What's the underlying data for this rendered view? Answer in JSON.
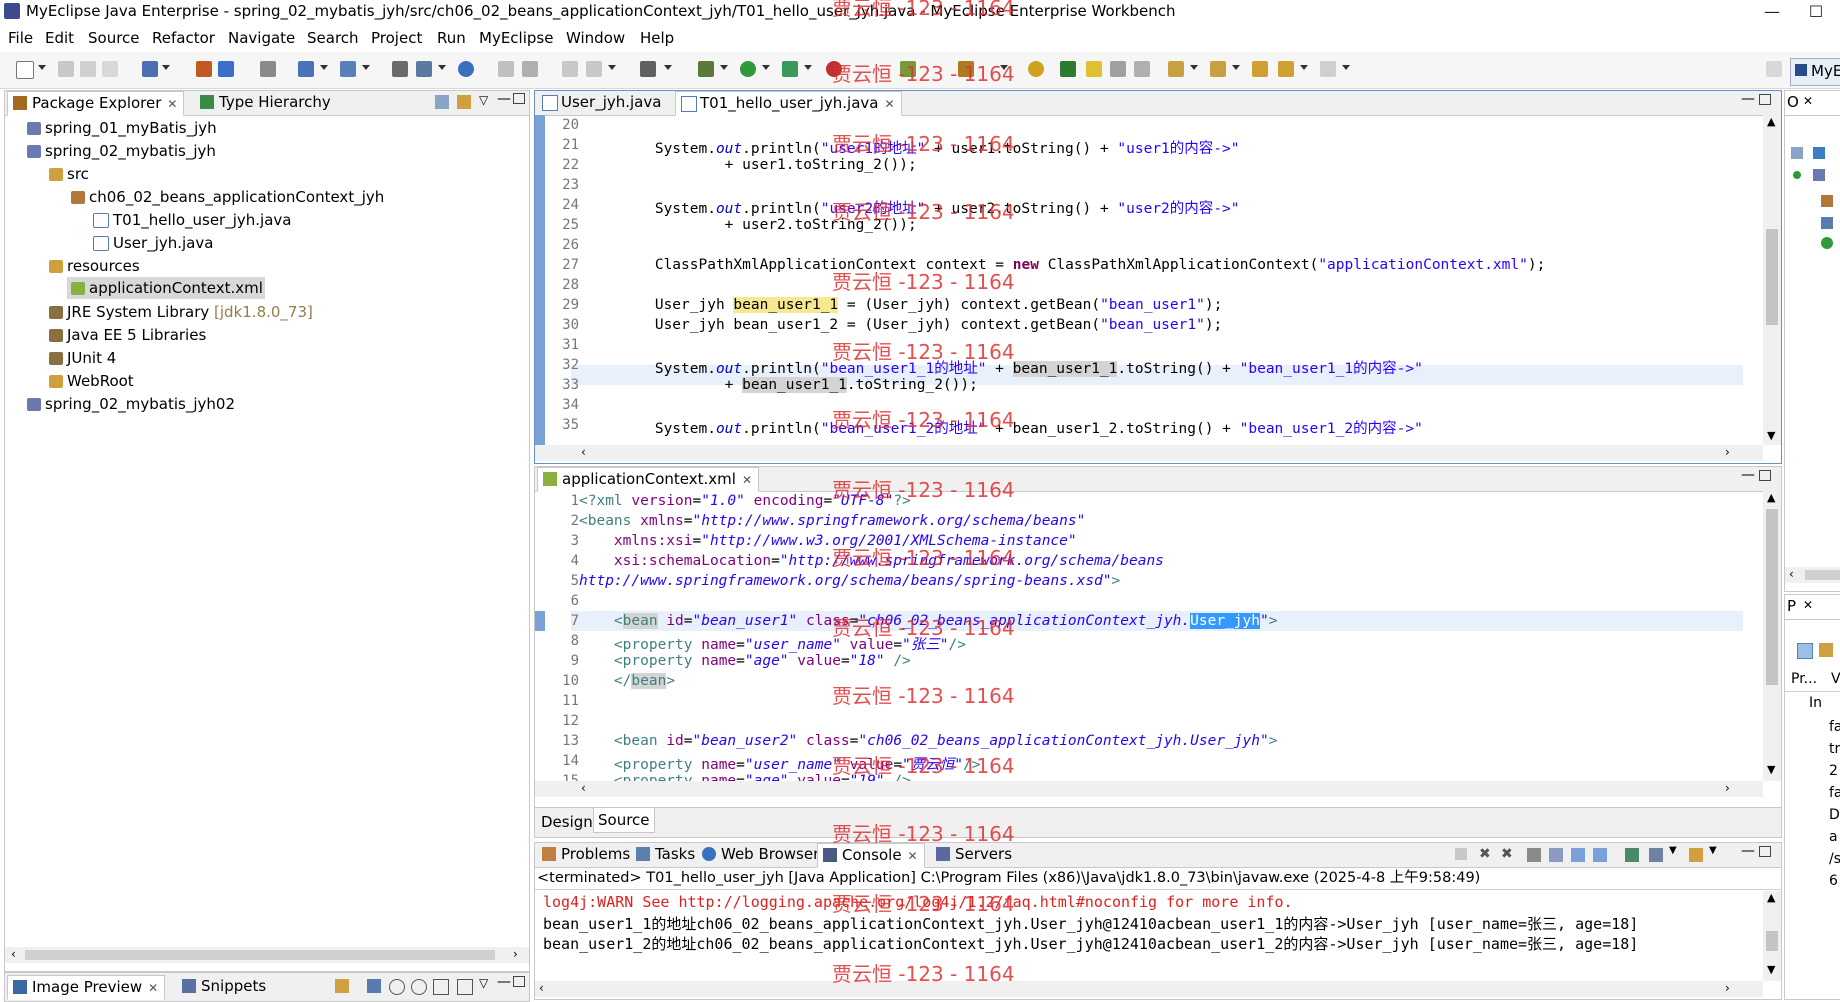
{
  "window": {
    "title": "MyEclipse Java Enterprise - spring_02_mybatis_jyh/src/ch06_02_beans_applicationContext_jyh/T01_hello_user_jyh.java - MyEclipse Enterprise Workbench",
    "minimize": "—",
    "maximize": "☐"
  },
  "menu": [
    "File",
    "Edit",
    "Source",
    "Refactor",
    "Navigate",
    "Search",
    "Project",
    "Run",
    "MyEclipse",
    "Window",
    "Help"
  ],
  "perspective": "MyE",
  "watermark": "贾云恒 -123 - 1164",
  "left_panel": {
    "tabs": [
      "Package Explorer",
      "Type Hierarchy"
    ],
    "tree": [
      {
        "label": "spring_01_myBatis_jyh",
        "depth": 0
      },
      {
        "label": "spring_02_mybatis_jyh",
        "depth": 0
      },
      {
        "label": "src",
        "depth": 1
      },
      {
        "label": "ch06_02_beans_applicationContext_jyh",
        "depth": 2
      },
      {
        "label": "T01_hello_user_jyh.java",
        "depth": 3
      },
      {
        "label": "User_jyh.java",
        "depth": 3
      },
      {
        "label": "resources",
        "depth": 1
      },
      {
        "label": "applicationContext.xml",
        "depth": 2
      },
      {
        "label": "JRE System Library",
        "suffix": "[jdk1.8.0_73]",
        "depth": 1
      },
      {
        "label": "Java EE 5 Libraries",
        "depth": 1
      },
      {
        "label": "JUnit 4",
        "depth": 1
      },
      {
        "label": "WebRoot",
        "depth": 1
      },
      {
        "label": "spring_02_mybatis_jyh02",
        "depth": 0
      }
    ],
    "bottom_tabs": [
      "Image Preview",
      "Snippets"
    ]
  },
  "java_editor": {
    "tabs": [
      "User_jyh.java",
      "T01_hello_user_jyh.java"
    ],
    "line_numbers": [
      "20",
      "21",
      "22",
      "23",
      "24",
      "25",
      "26",
      "27",
      "28",
      "29",
      "30",
      "31",
      "32",
      "33",
      "34",
      "35"
    ]
  },
  "xml_editor": {
    "tab": "applicationContext.xml",
    "line_numbers": [
      "1",
      "2",
      "3",
      "4",
      "5",
      "6",
      "7",
      "8",
      "9",
      "10",
      "11",
      "12",
      "13",
      "14",
      "15"
    ],
    "bottom_tabs": [
      "Design",
      "Source"
    ]
  },
  "console": {
    "tabs": [
      "Problems",
      "Tasks",
      "Web Browser",
      "Console",
      "Servers"
    ],
    "header": "<terminated> T01_hello_user_jyh [Java Application] C:\\Program Files (x86)\\Java\\jdk1.8.0_73\\bin\\javaw.exe (2025-4-8 上午9:58:49)",
    "lines": [
      "log4j:WARN See http://logging.apache.org/log4j/1.2/faq.html#noconfig for more info.",
      "bean_user1_1的地址ch06_02_beans_applicationContext_jyh.User_jyh@12410acbean_user1_1的内容->User_jyh [user_name=张三, age=18]",
      "bean_user1_2的地址ch06_02_beans_applicationContext_jyh.User_jyh@12410acbean_user1_2的内容->User_jyh [user_name=张三, age=18]"
    ]
  },
  "right_panel": {
    "outline_tab": "O",
    "properties_tab": "P",
    "col_labels": [
      "Pr...",
      "V",
      "In"
    ],
    "values": [
      "fa",
      "tr",
      "2",
      "fa",
      "D",
      "a",
      "/s",
      "6"
    ]
  }
}
